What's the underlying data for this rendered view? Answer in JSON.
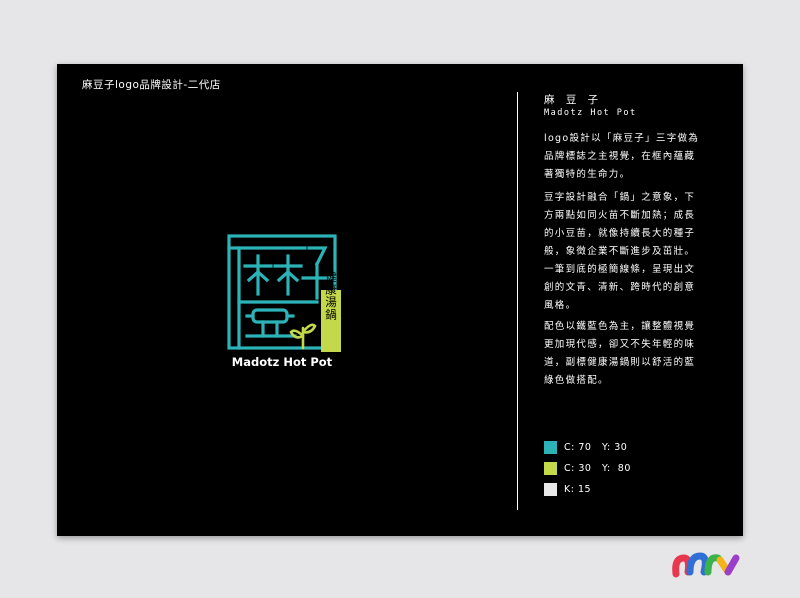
{
  "card_title": "麻豆子logo品牌設計-二代店",
  "logo": {
    "badge_text": "健康湯鍋",
    "wordmark": "Madotz Hot Pot",
    "colors": {
      "primary": "#2bb3b8",
      "accent": "#c3d84a"
    }
  },
  "brand": {
    "name": "麻 豆 子",
    "english": "Madotz  Hot  Pot"
  },
  "paragraphs": [
    "logo設計以「麻豆子」三字做為\n品牌標誌之主視覺，在框內蘊藏\n著獨特的生命力。",
    "豆字設計融合「鍋」之意象，下\n方兩點如同火苗不斷加熱；成長\n的小豆苗，就像持續長大的種子\n般，象徵企業不斷進步及茁壯。\n一筆到底的極簡線條，呈現出文\n創的文青、清新、跨時代的創意\n風格。",
    "配色以鐵藍色為主，讓整體視覺\n更加現代感，卻又不失年輕的味\n道，副標健康湯鍋則以舒活的藍\n綠色做搭配。"
  ],
  "swatches": [
    {
      "label": "C: 70   Y: 30",
      "color": "#2bb3b8"
    },
    {
      "label": "C: 30   Y:  80",
      "color": "#c3d84a"
    },
    {
      "label": "K: 15",
      "color": "#e8e8e8"
    }
  ],
  "corner_logo_colors": [
    "#e8384f",
    "#2f6fd6",
    "#3bb34a",
    "#f2b418",
    "#9b3fc9"
  ]
}
